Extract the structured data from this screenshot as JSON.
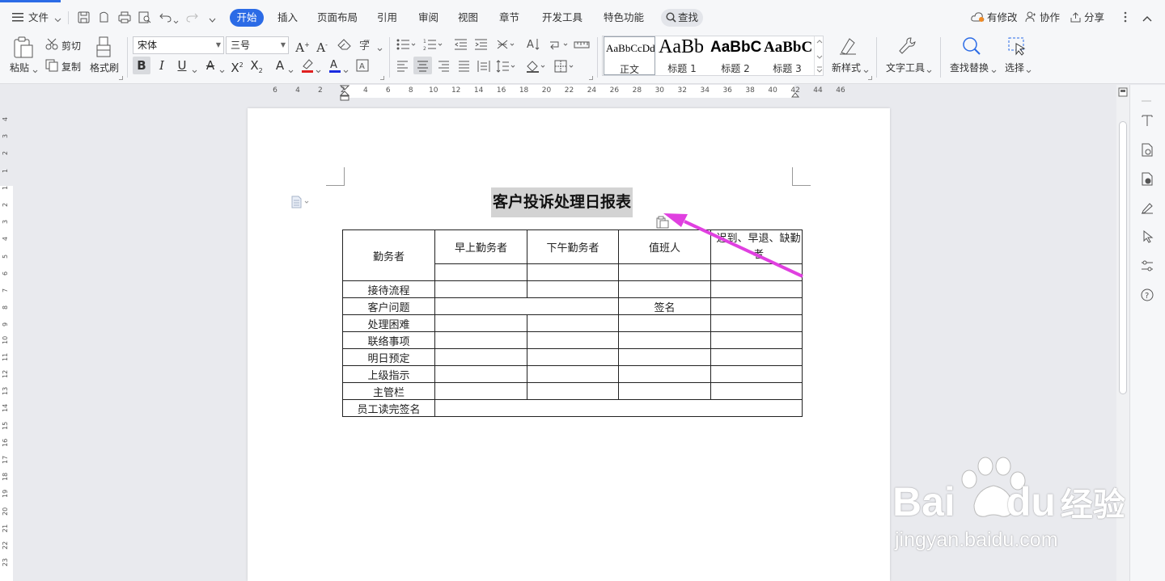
{
  "menubar": {
    "file_label": "文件",
    "tabs": [
      {
        "label": "开始",
        "active": true
      },
      {
        "label": "插入"
      },
      {
        "label": "页面布局"
      },
      {
        "label": "引用"
      },
      {
        "label": "审阅"
      },
      {
        "label": "视图"
      },
      {
        "label": "章节"
      },
      {
        "label": "开发工具"
      },
      {
        "label": "特色功能"
      }
    ],
    "search_label": "查找",
    "right": {
      "changes_label": "有修改",
      "collab_label": "协作",
      "share_label": "分享"
    }
  },
  "ribbon": {
    "paste_label": "粘贴",
    "cut_label": "剪切",
    "copy_label": "复制",
    "format_painter_label": "格式刷",
    "font_name": "宋体",
    "font_size": "三号",
    "styles": [
      {
        "sample": "AaBbCcDd",
        "name": "正文"
      },
      {
        "sample": "AaBb",
        "name": "标题 1"
      },
      {
        "sample": "AaBbC",
        "name": "标题 2"
      },
      {
        "sample": "AaBbC",
        "name": "标题 3"
      }
    ],
    "new_style_label": "新样式",
    "text_tools_label": "文字工具",
    "find_replace_label": "查找替换",
    "select_label": "选择"
  },
  "ruler": {
    "h_ticks": [
      "6",
      "4",
      "2",
      "2",
      "4",
      "6",
      "8",
      "10",
      "12",
      "14",
      "16",
      "18",
      "20",
      "22",
      "24",
      "26",
      "28",
      "30",
      "32",
      "34",
      "36",
      "38",
      "40",
      "42",
      "44",
      "46"
    ],
    "v_ticks": [
      "4",
      "3",
      "2",
      "1",
      "1",
      "2",
      "3",
      "4",
      "5",
      "6",
      "7",
      "8",
      "9",
      "10",
      "11",
      "12",
      "13",
      "14",
      "15",
      "16",
      "17",
      "18",
      "19",
      "20",
      "21",
      "22",
      "23"
    ]
  },
  "document": {
    "title": "客户投诉处理日报表",
    "table": {
      "header": {
        "c0": "勤务者",
        "c1": "早上勤务者",
        "c2": "下午勤务者",
        "c3": "值班人",
        "c4": "迟到、早退、缺勤者"
      },
      "rows": [
        {
          "label": "接待流程"
        },
        {
          "label": "客户问题",
          "sign": "签名"
        },
        {
          "label": "处理困难"
        },
        {
          "label": "联络事项"
        },
        {
          "label": "明日预定"
        },
        {
          "label": "上级指示"
        },
        {
          "label": "主管栏"
        },
        {
          "label": "员工读完签名"
        }
      ]
    }
  },
  "watermark": {
    "brand_a": "Bai",
    "brand_b": "du",
    "brand_cn": "经验",
    "url": "jingyan.baidu.com"
  },
  "colors": {
    "accent": "#2b6be6",
    "arrow": "#e040e0",
    "title_highlight": "#d3d3d3"
  }
}
